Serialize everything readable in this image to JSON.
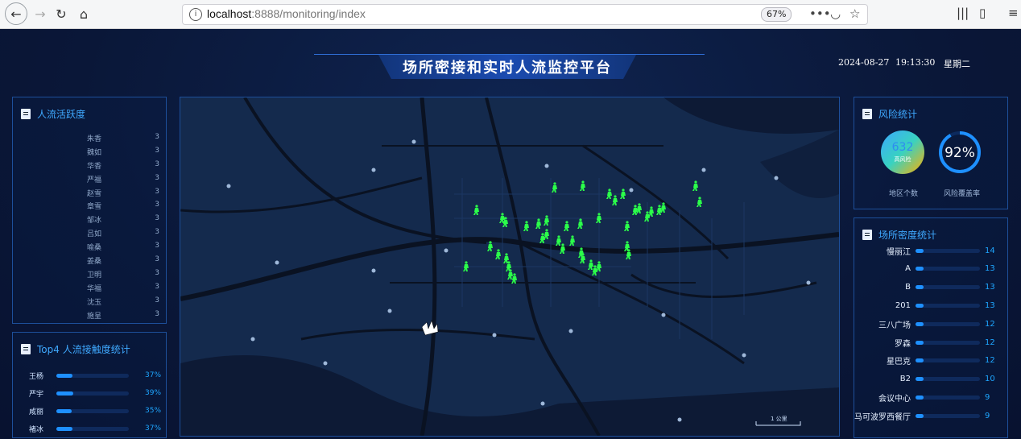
{
  "browser": {
    "url_host": "localhost",
    "url_path": ":8888/monitoring/index",
    "zoom": "67%"
  },
  "header": {
    "title": "场所密接和实时人流监控平台",
    "date": "2024-08-27",
    "time": "19:13:30",
    "weekday": "星期二"
  },
  "activity_panel": {
    "title": "人流活跃度",
    "rows": [
      {
        "name": "朱香",
        "value": "3"
      },
      {
        "name": "魏如",
        "value": "3"
      },
      {
        "name": "华香",
        "value": "3"
      },
      {
        "name": "严福",
        "value": "3"
      },
      {
        "name": "赵雪",
        "value": "3"
      },
      {
        "name": "章雪",
        "value": "3"
      },
      {
        "name": "邹冰",
        "value": "3"
      },
      {
        "name": "吕如",
        "value": "3"
      },
      {
        "name": "喻桑",
        "value": "3"
      },
      {
        "name": "姜桑",
        "value": "3"
      },
      {
        "name": "卫明",
        "value": "3"
      },
      {
        "name": "华福",
        "value": "3"
      },
      {
        "name": "沈玉",
        "value": "3"
      },
      {
        "name": "施呈",
        "value": "3"
      }
    ]
  },
  "top4_panel": {
    "title": "Top4 人流接触度统计",
    "rows": [
      {
        "name": "王杨",
        "pct": "37%",
        "fraction": 0.37
      },
      {
        "name": "严宇",
        "pct": "39%",
        "fraction": 0.39
      },
      {
        "name": "咸丽",
        "pct": "35%",
        "fraction": 0.35
      },
      {
        "name": "褚冰",
        "pct": "37%",
        "fraction": 0.37
      }
    ]
  },
  "risk_panel": {
    "title": "风险统计",
    "area_count": "632",
    "area_sub": "高风险",
    "area_label": "地区个数",
    "coverage": "92%",
    "coverage_fraction": 0.92,
    "coverage_label": "风险覆盖率"
  },
  "density_panel": {
    "title": "场所密度统计",
    "rows": [
      {
        "name": "慢丽江",
        "value": "14"
      },
      {
        "name": "A",
        "value": "13"
      },
      {
        "name": "B",
        "value": "13"
      },
      {
        "name": "201",
        "value": "13"
      },
      {
        "name": "三八广场",
        "value": "12"
      },
      {
        "name": "罗森",
        "value": "12"
      },
      {
        "name": "星巴克",
        "value": "12"
      },
      {
        "name": "B2",
        "value": "10"
      },
      {
        "name": "会议中心",
        "value": "9"
      },
      {
        "name": "马可波罗西餐厅",
        "value": "9"
      }
    ]
  },
  "map": {
    "scale_label": "1 公里",
    "colors": {
      "person": "#2bff4a",
      "road": "#0a1222",
      "water": "#0e1c36"
    }
  }
}
